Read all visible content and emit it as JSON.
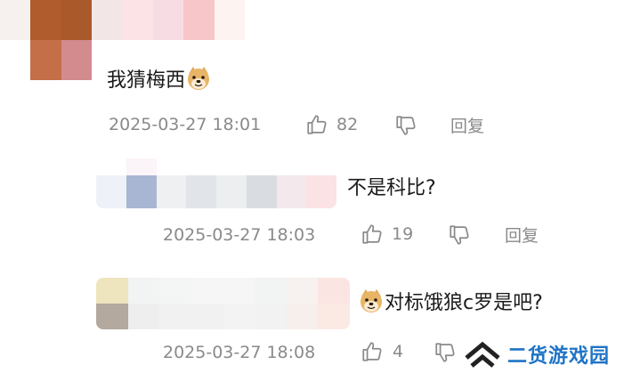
{
  "comments": [
    {
      "text": "我猜梅西",
      "emoji": "doge-emoji",
      "timestamp": "2025-03-27 18:01",
      "likes": "82",
      "reply_label": "回复"
    },
    {
      "text": "不是科比?",
      "timestamp": "2025-03-27 18:03",
      "likes": "19",
      "reply_label": "回复"
    },
    {
      "text": "对标饿狼c罗是吧?",
      "emoji": "doge-emoji",
      "timestamp": "2025-03-27 18:08",
      "likes": "4"
    }
  ],
  "watermark": {
    "text": "二货游戏园",
    "icon": "double-chevron-up-logo"
  },
  "colors": {
    "text": "#1a1a1a",
    "meta": "#8a8a8a",
    "watermark": "#1f74c6"
  }
}
